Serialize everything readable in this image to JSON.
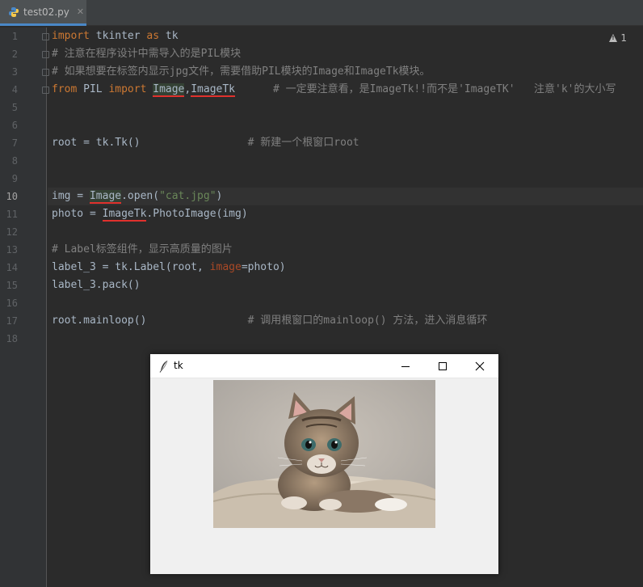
{
  "tab": {
    "filename": "test02.py",
    "close": "✕"
  },
  "warnings": {
    "count": "1"
  },
  "line_numbers": [
    "1",
    "2",
    "3",
    "4",
    "5",
    "6",
    "7",
    "8",
    "9",
    "10",
    "11",
    "12",
    "13",
    "14",
    "15",
    "16",
    "17",
    "18"
  ],
  "current_line": "10",
  "code": {
    "l1": {
      "kw1": "import",
      "mod": " tkinter ",
      "kw2": "as",
      "alias": " tk"
    },
    "l2": "# 注意在程序设计中需导入的是PIL模块",
    "l3": "# 如果想要在标签内显示jpg文件，需要借助PIL模块的Image和ImageTk模块。",
    "l4": {
      "kw_from": "from",
      "pkg": " PIL ",
      "kw_import": "import",
      "sp": " ",
      "image": "Image",
      "comma": ",",
      "imagetk": "ImageTk",
      "gap": "      ",
      "comment": "# 一定要注意看，是ImageTk!!而不是'ImageTK'   注意'k'的大小写"
    },
    "l7": {
      "code": "root = tk.Tk()",
      "gap": "                 ",
      "comment": "# 新建一个根窗口root"
    },
    "l10": {
      "pre": "img = ",
      "image": "Image",
      "mid": ".open(",
      "str": "\"cat.jpg\"",
      "post": ")"
    },
    "l11": {
      "pre": "photo = ",
      "imagetk": "ImageTk",
      "post": ".PhotoImage(img)"
    },
    "l13": "# Label标签组件，显示高质量的图片",
    "l14": {
      "pre": "label_3 = tk.Label(root, ",
      "param": "image",
      "post": "=photo)"
    },
    "l15": "label_3.pack()",
    "l17": {
      "code": "root.mainloop()",
      "gap": "                ",
      "comment": "# 调用根窗口的mainloop() 方法，进入消息循环"
    }
  },
  "tk_window": {
    "title": "tk",
    "close_glyph": "✕",
    "image_subject": "kitten photo"
  },
  "colors": {
    "keyword": "#cc7832",
    "comment": "#808080",
    "string": "#6a8759",
    "error_underline": "#e0312d"
  }
}
